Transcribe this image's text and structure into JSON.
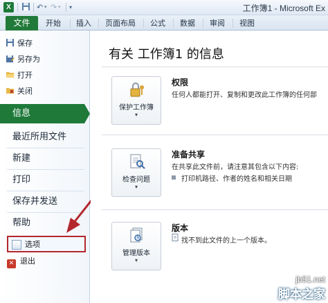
{
  "window": {
    "title": "工作簿1 - Microsoft Ex",
    "app_icon": "X"
  },
  "qat": {
    "save_icon": "save-icon",
    "undo_icon": "undo-icon",
    "redo_icon": "redo-icon"
  },
  "ribbon": {
    "file_tab": "文件",
    "tabs": [
      "开始",
      "插入",
      "页面布局",
      "公式",
      "数据",
      "审阅",
      "视图"
    ]
  },
  "backstage": {
    "commands": [
      {
        "label": "保存",
        "icon": "save-icon"
      },
      {
        "label": "另存为",
        "icon": "save-as-icon"
      },
      {
        "label": "打开",
        "icon": "open-folder-icon"
      },
      {
        "label": "关闭",
        "icon": "close-folder-icon"
      }
    ],
    "active_nav": "信息",
    "nav": [
      "最近所用文件",
      "新建",
      "打印",
      "保存并发送",
      "帮助"
    ],
    "options_label": "选项",
    "exit_label": "退出"
  },
  "info": {
    "title": "有关 工作簿1 的信息",
    "sections": [
      {
        "button_label": "保护工作簿",
        "icon": "lock-key-icon",
        "heading": "权限",
        "text": "任何人都能打开、复制和更改此工作簿的任何部"
      },
      {
        "button_label": "检查问题",
        "icon": "inspect-document-icon",
        "heading": "准备共享",
        "text": "在共享此文件前，请注意其包含以下内容:",
        "bullet": "打印机路径、作者的姓名和相关日期"
      },
      {
        "button_label": "管理版本",
        "icon": "versions-icon",
        "heading": "版本",
        "text": "找不到此文件的上一个版本。"
      }
    ]
  },
  "watermark": {
    "site": "jb51.net",
    "brand": "脚本之家"
  },
  "colors": {
    "file_green": "#217a3a",
    "highlight_red": "#b3272d",
    "annotation_arrow": "#b3272d"
  }
}
